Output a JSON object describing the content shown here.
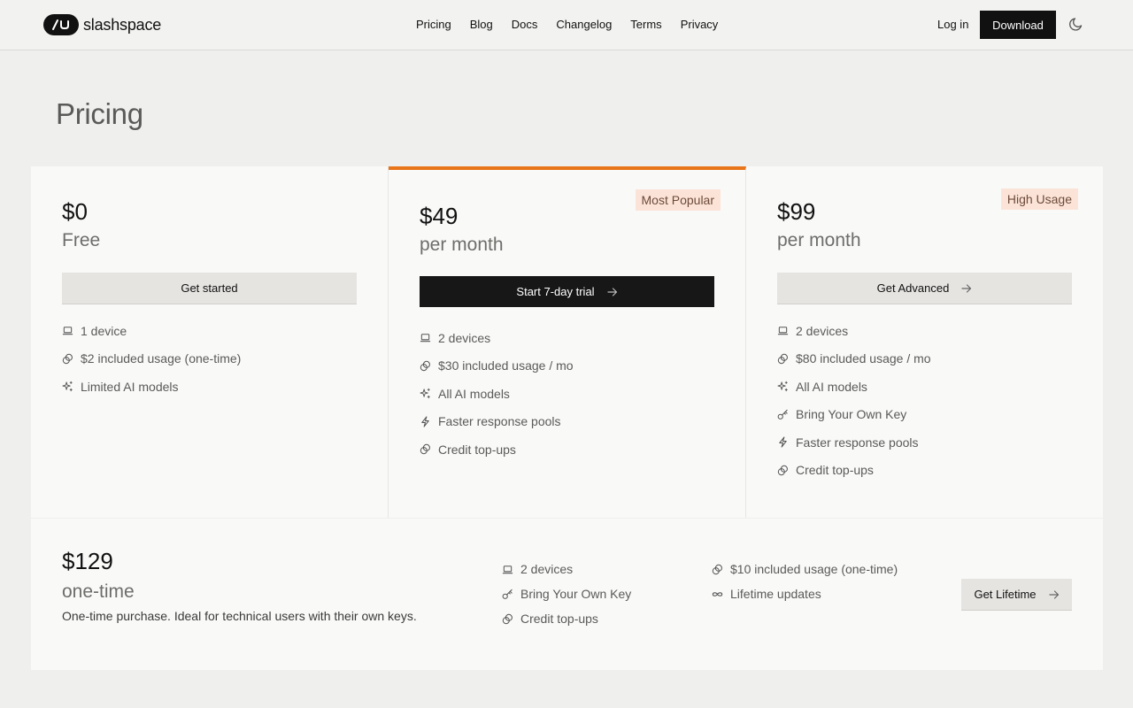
{
  "header": {
    "logo_text": "slashspace",
    "nav": [
      "Pricing",
      "Blog",
      "Docs",
      "Changelog",
      "Terms",
      "Privacy"
    ],
    "login_label": "Log in",
    "download_label": "Download"
  },
  "page": {
    "title": "Pricing"
  },
  "plans": [
    {
      "price": "$0",
      "period": "Free",
      "cta": "Get started",
      "features": [
        {
          "icon": "laptop-icon",
          "text": "1 device"
        },
        {
          "icon": "coins-icon",
          "text": "$2 included usage (one-time)"
        },
        {
          "icon": "sparkles-icon",
          "text": "Limited AI models"
        }
      ]
    },
    {
      "price": "$49",
      "period": "per month",
      "badge": "Most Popular",
      "cta": "Start 7-day trial",
      "accent": "#e8751a",
      "features": [
        {
          "icon": "laptop-icon",
          "text": "2 devices"
        },
        {
          "icon": "coins-icon",
          "text": "$30 included usage / mo"
        },
        {
          "icon": "sparkles-icon",
          "text": "All AI models"
        },
        {
          "icon": "lightning-icon",
          "text": "Faster response pools"
        },
        {
          "icon": "coins-icon",
          "text": "Credit top-ups"
        }
      ]
    },
    {
      "price": "$99",
      "period": "per month",
      "badge": "High Usage",
      "cta": "Get Advanced",
      "features": [
        {
          "icon": "laptop-icon",
          "text": "2 devices"
        },
        {
          "icon": "coins-icon",
          "text": "$80 included usage / mo"
        },
        {
          "icon": "sparkles-icon",
          "text": "All AI models"
        },
        {
          "icon": "key-icon",
          "text": "Bring Your Own Key"
        },
        {
          "icon": "lightning-icon",
          "text": "Faster response pools"
        },
        {
          "icon": "coins-icon",
          "text": "Credit top-ups"
        }
      ]
    }
  ],
  "lifetime": {
    "price": "$129",
    "period": "one-time",
    "description": "One-time purchase. Ideal for technical users with their own keys.",
    "features_col1": [
      {
        "icon": "laptop-icon",
        "text": "2 devices"
      },
      {
        "icon": "key-icon",
        "text": "Bring Your Own Key"
      },
      {
        "icon": "coins-icon",
        "text": "Credit top-ups"
      }
    ],
    "features_col2": [
      {
        "icon": "coins-icon",
        "text": "$10 included usage (one-time)"
      },
      {
        "icon": "infinity-icon",
        "text": "Lifetime updates"
      }
    ],
    "cta": "Get Lifetime"
  }
}
